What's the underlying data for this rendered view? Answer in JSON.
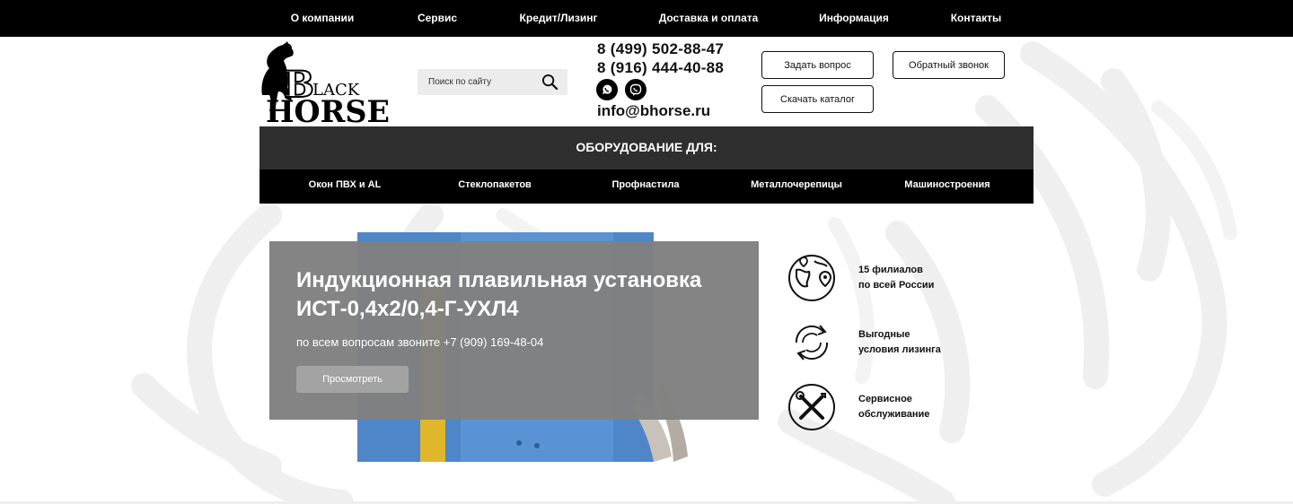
{
  "top_nav": [
    {
      "label": "О компании"
    },
    {
      "label": "Сервис"
    },
    {
      "label": "Кредит/Лизинг"
    },
    {
      "label": "Доставка и оплата"
    },
    {
      "label": "Информация"
    },
    {
      "label": "Контакты"
    }
  ],
  "logo": {
    "line1": "LACK",
    "line2": "HORSE",
    "letter_b": "B"
  },
  "search": {
    "placeholder": "Поиск по сайту",
    "icon": "search-icon"
  },
  "contacts": {
    "phone1": "8 (499) 502-88-47",
    "phone2": "8 (916) 444-40-88",
    "email": "info@bhorse.ru",
    "messengers": [
      "whatsapp-icon",
      "viber-icon"
    ]
  },
  "buttons": {
    "ask": "Задать вопрос",
    "callback": "Обратный звонок",
    "catalog": "Скачать каталог"
  },
  "equipment": {
    "heading": "ОБОРУДОВАНИЕ ДЛЯ:",
    "categories": [
      {
        "label": "Окон ПВХ и AL"
      },
      {
        "label": "Стеклопакетов"
      },
      {
        "label": "Профнастила"
      },
      {
        "label": "Металлочерепицы"
      },
      {
        "label": "Машиностроения"
      }
    ]
  },
  "hero": {
    "title": "Индукционная плавильная установка ИСТ-0,4х2/0,4-Г-УХЛ4",
    "subtitle": "по всем вопросам звоните +7 (909) 169-48-04",
    "button": "Просмотреть"
  },
  "features": [
    {
      "icon": "globe-pin-icon",
      "line1": "15 филиалов",
      "line2": "по всей России"
    },
    {
      "icon": "refresh-cycle-icon",
      "line1": "Выгодные",
      "line2": "условия лизинга"
    },
    {
      "icon": "tools-icon",
      "line1": "Сервисное",
      "line2": "обслуживание"
    }
  ],
  "colors": {
    "topbar": "#000000",
    "equip_header": "#2f2f2f",
    "hero_overlay": "#808080",
    "product_blue": "#4f86c8"
  }
}
